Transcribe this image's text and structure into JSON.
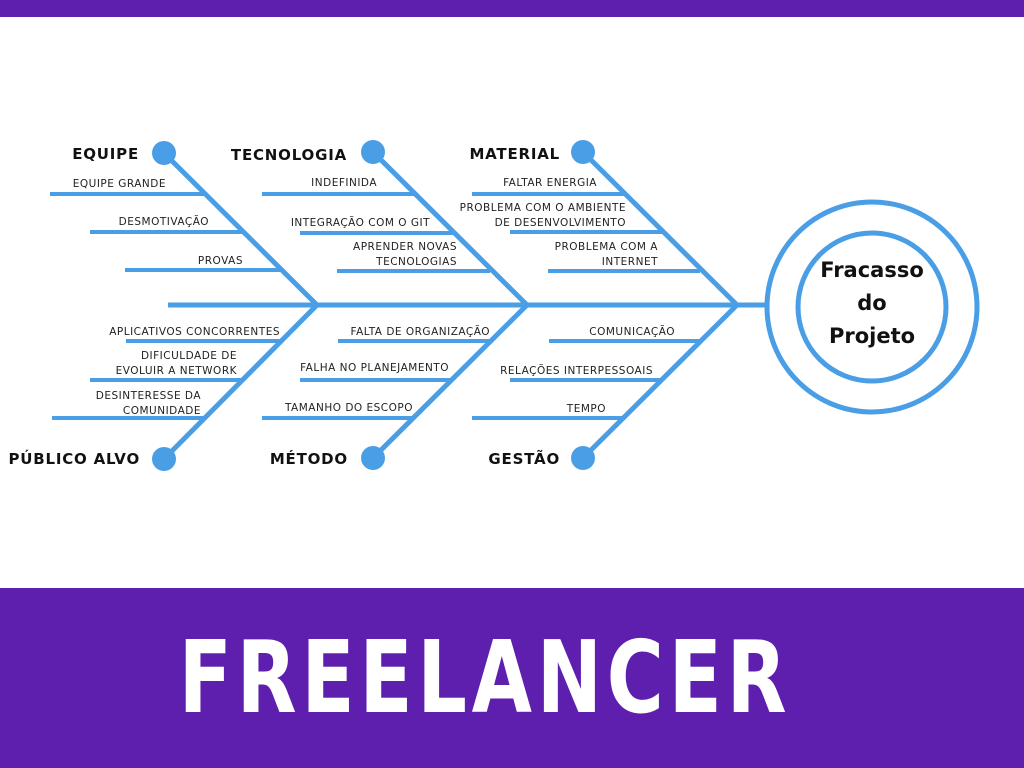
{
  "head": {
    "lines": [
      "Fracasso",
      "do",
      "Projeto"
    ]
  },
  "categories": [
    {
      "label": "EQUIPE",
      "causes": [
        [
          "EQUIPE GRANDE"
        ],
        [
          "DESMOTIVAÇÃO"
        ],
        [
          "PROVAS"
        ]
      ]
    },
    {
      "label": "TECNOLOGIA",
      "causes": [
        [
          "INDEFINIDA"
        ],
        [
          "INTEGRAÇÃO COM O GIT"
        ],
        [
          "APRENDER NOVAS",
          "TECNOLOGIAS"
        ]
      ]
    },
    {
      "label": "MATERIAL",
      "causes": [
        [
          "FALTAR ENERGIA"
        ],
        [
          "PROBLEMA COM O AMBIENTE",
          "DE DESENVOLVIMENTO"
        ],
        [
          "PROBLEMA COM A",
          "INTERNET"
        ]
      ]
    },
    {
      "label": "PÚBLICO ALVO",
      "causes": [
        [
          "APLICATIVOS CONCORRENTES"
        ],
        [
          "DIFICULDADE DE",
          "EVOLUIR A NETWORK"
        ],
        [
          "DESINTERESSE DA",
          "COMUNIDADE"
        ]
      ]
    },
    {
      "label": "MÉTODO",
      "causes": [
        [
          "FALTA DE ORGANIZAÇÃO"
        ],
        [
          "FALHA NO PLANEJAMENTO"
        ],
        [
          "TAMANHO DO ESCOPO"
        ]
      ]
    },
    {
      "label": "GESTÃO",
      "causes": [
        [
          "COMUNICAÇÃO"
        ],
        [
          "RELAÇÕES INTERPESSOAIS"
        ],
        [
          "TEMPO"
        ]
      ]
    }
  ],
  "banner": {
    "title": "FREELANCER"
  },
  "colors": {
    "bone": "#4a9ee6",
    "banner": "#5e1fae",
    "text": "#111111"
  }
}
